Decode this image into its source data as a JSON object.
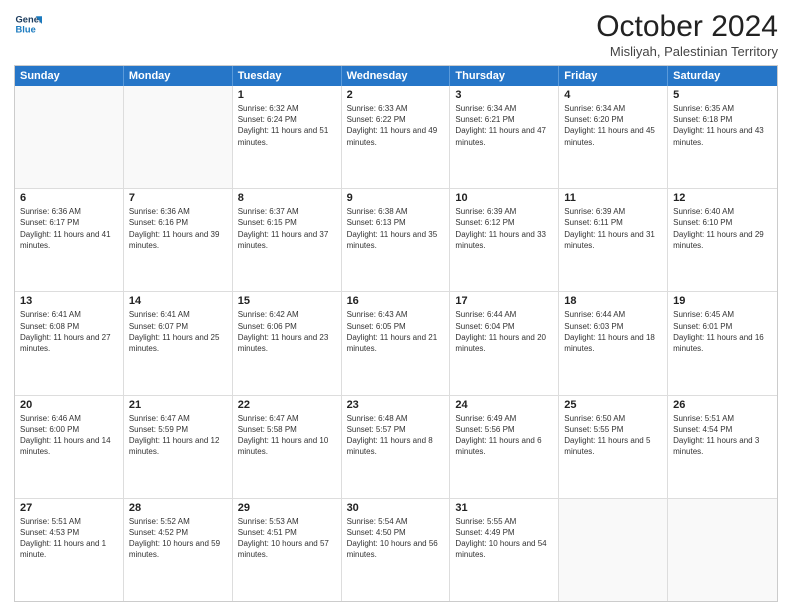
{
  "logo": {
    "line1": "General",
    "line2": "Blue"
  },
  "header": {
    "month": "October 2024",
    "location": "Misliyah, Palestinian Territory"
  },
  "days_of_week": [
    "Sunday",
    "Monday",
    "Tuesday",
    "Wednesday",
    "Thursday",
    "Friday",
    "Saturday"
  ],
  "weeks": [
    [
      {
        "day": "",
        "empty": true
      },
      {
        "day": "",
        "empty": true
      },
      {
        "day": "1",
        "sunrise": "Sunrise: 6:32 AM",
        "sunset": "Sunset: 6:24 PM",
        "daylight": "Daylight: 11 hours and 51 minutes."
      },
      {
        "day": "2",
        "sunrise": "Sunrise: 6:33 AM",
        "sunset": "Sunset: 6:22 PM",
        "daylight": "Daylight: 11 hours and 49 minutes."
      },
      {
        "day": "3",
        "sunrise": "Sunrise: 6:34 AM",
        "sunset": "Sunset: 6:21 PM",
        "daylight": "Daylight: 11 hours and 47 minutes."
      },
      {
        "day": "4",
        "sunrise": "Sunrise: 6:34 AM",
        "sunset": "Sunset: 6:20 PM",
        "daylight": "Daylight: 11 hours and 45 minutes."
      },
      {
        "day": "5",
        "sunrise": "Sunrise: 6:35 AM",
        "sunset": "Sunset: 6:18 PM",
        "daylight": "Daylight: 11 hours and 43 minutes."
      }
    ],
    [
      {
        "day": "6",
        "sunrise": "Sunrise: 6:36 AM",
        "sunset": "Sunset: 6:17 PM",
        "daylight": "Daylight: 11 hours and 41 minutes."
      },
      {
        "day": "7",
        "sunrise": "Sunrise: 6:36 AM",
        "sunset": "Sunset: 6:16 PM",
        "daylight": "Daylight: 11 hours and 39 minutes."
      },
      {
        "day": "8",
        "sunrise": "Sunrise: 6:37 AM",
        "sunset": "Sunset: 6:15 PM",
        "daylight": "Daylight: 11 hours and 37 minutes."
      },
      {
        "day": "9",
        "sunrise": "Sunrise: 6:38 AM",
        "sunset": "Sunset: 6:13 PM",
        "daylight": "Daylight: 11 hours and 35 minutes."
      },
      {
        "day": "10",
        "sunrise": "Sunrise: 6:39 AM",
        "sunset": "Sunset: 6:12 PM",
        "daylight": "Daylight: 11 hours and 33 minutes."
      },
      {
        "day": "11",
        "sunrise": "Sunrise: 6:39 AM",
        "sunset": "Sunset: 6:11 PM",
        "daylight": "Daylight: 11 hours and 31 minutes."
      },
      {
        "day": "12",
        "sunrise": "Sunrise: 6:40 AM",
        "sunset": "Sunset: 6:10 PM",
        "daylight": "Daylight: 11 hours and 29 minutes."
      }
    ],
    [
      {
        "day": "13",
        "sunrise": "Sunrise: 6:41 AM",
        "sunset": "Sunset: 6:08 PM",
        "daylight": "Daylight: 11 hours and 27 minutes."
      },
      {
        "day": "14",
        "sunrise": "Sunrise: 6:41 AM",
        "sunset": "Sunset: 6:07 PM",
        "daylight": "Daylight: 11 hours and 25 minutes."
      },
      {
        "day": "15",
        "sunrise": "Sunrise: 6:42 AM",
        "sunset": "Sunset: 6:06 PM",
        "daylight": "Daylight: 11 hours and 23 minutes."
      },
      {
        "day": "16",
        "sunrise": "Sunrise: 6:43 AM",
        "sunset": "Sunset: 6:05 PM",
        "daylight": "Daylight: 11 hours and 21 minutes."
      },
      {
        "day": "17",
        "sunrise": "Sunrise: 6:44 AM",
        "sunset": "Sunset: 6:04 PM",
        "daylight": "Daylight: 11 hours and 20 minutes."
      },
      {
        "day": "18",
        "sunrise": "Sunrise: 6:44 AM",
        "sunset": "Sunset: 6:03 PM",
        "daylight": "Daylight: 11 hours and 18 minutes."
      },
      {
        "day": "19",
        "sunrise": "Sunrise: 6:45 AM",
        "sunset": "Sunset: 6:01 PM",
        "daylight": "Daylight: 11 hours and 16 minutes."
      }
    ],
    [
      {
        "day": "20",
        "sunrise": "Sunrise: 6:46 AM",
        "sunset": "Sunset: 6:00 PM",
        "daylight": "Daylight: 11 hours and 14 minutes."
      },
      {
        "day": "21",
        "sunrise": "Sunrise: 6:47 AM",
        "sunset": "Sunset: 5:59 PM",
        "daylight": "Daylight: 11 hours and 12 minutes."
      },
      {
        "day": "22",
        "sunrise": "Sunrise: 6:47 AM",
        "sunset": "Sunset: 5:58 PM",
        "daylight": "Daylight: 11 hours and 10 minutes."
      },
      {
        "day": "23",
        "sunrise": "Sunrise: 6:48 AM",
        "sunset": "Sunset: 5:57 PM",
        "daylight": "Daylight: 11 hours and 8 minutes."
      },
      {
        "day": "24",
        "sunrise": "Sunrise: 6:49 AM",
        "sunset": "Sunset: 5:56 PM",
        "daylight": "Daylight: 11 hours and 6 minutes."
      },
      {
        "day": "25",
        "sunrise": "Sunrise: 6:50 AM",
        "sunset": "Sunset: 5:55 PM",
        "daylight": "Daylight: 11 hours and 5 minutes."
      },
      {
        "day": "26",
        "sunrise": "Sunrise: 5:51 AM",
        "sunset": "Sunset: 4:54 PM",
        "daylight": "Daylight: 11 hours and 3 minutes."
      }
    ],
    [
      {
        "day": "27",
        "sunrise": "Sunrise: 5:51 AM",
        "sunset": "Sunset: 4:53 PM",
        "daylight": "Daylight: 11 hours and 1 minute."
      },
      {
        "day": "28",
        "sunrise": "Sunrise: 5:52 AM",
        "sunset": "Sunset: 4:52 PM",
        "daylight": "Daylight: 10 hours and 59 minutes."
      },
      {
        "day": "29",
        "sunrise": "Sunrise: 5:53 AM",
        "sunset": "Sunset: 4:51 PM",
        "daylight": "Daylight: 10 hours and 57 minutes."
      },
      {
        "day": "30",
        "sunrise": "Sunrise: 5:54 AM",
        "sunset": "Sunset: 4:50 PM",
        "daylight": "Daylight: 10 hours and 56 minutes."
      },
      {
        "day": "31",
        "sunrise": "Sunrise: 5:55 AM",
        "sunset": "Sunset: 4:49 PM",
        "daylight": "Daylight: 10 hours and 54 minutes."
      },
      {
        "day": "",
        "empty": true
      },
      {
        "day": "",
        "empty": true
      }
    ]
  ]
}
